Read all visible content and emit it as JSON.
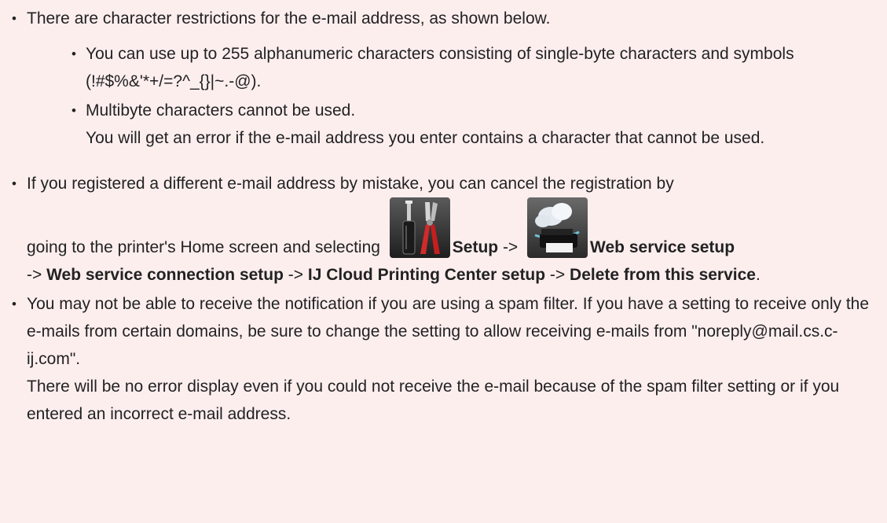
{
  "bullet1": {
    "text": "There are character restrictions for the e-mail address, as shown below.",
    "sub1": "You can use up to 255 alphanumeric characters consisting of single-byte characters and symbols (!#$%&'*+/=?^_{}|~.-@).",
    "sub2_line1": "Multibyte characters cannot be used.",
    "sub2_line2": "You will get an error if the e-mail address you enter contains a character that cannot be used."
  },
  "bullet2": {
    "lead": "If you registered a different e-mail address by mistake, you can cancel the registration by",
    "going_to": "going to the printer's Home screen and selecting ",
    "setup": "Setup",
    "arrow": " -> ",
    "web_service_setup": "Web service setup",
    "web_service_connection_setup": "Web service connection setup",
    "ij_cloud_printing_center_setup": "IJ Cloud Printing Center setup",
    "delete_from_this_service": "Delete from this service",
    "period": "."
  },
  "bullet3": {
    "line1": "You may not be able to receive the notification if you are using a spam filter. If you have a setting to receive only the e-mails from certain domains, be sure to change the setting to allow receiving e-mails from \"noreply@mail.cs.c-ij.com\".",
    "line2": "There will be no error display even if you could not receive the e-mail because of the spam filter setting or if you entered an incorrect e-mail address."
  },
  "icons": {
    "setup": "setup-tools-icon",
    "web_service": "cloud-printer-icon"
  },
  "colors": {
    "background": "#fdeeee",
    "text": "#222222"
  }
}
